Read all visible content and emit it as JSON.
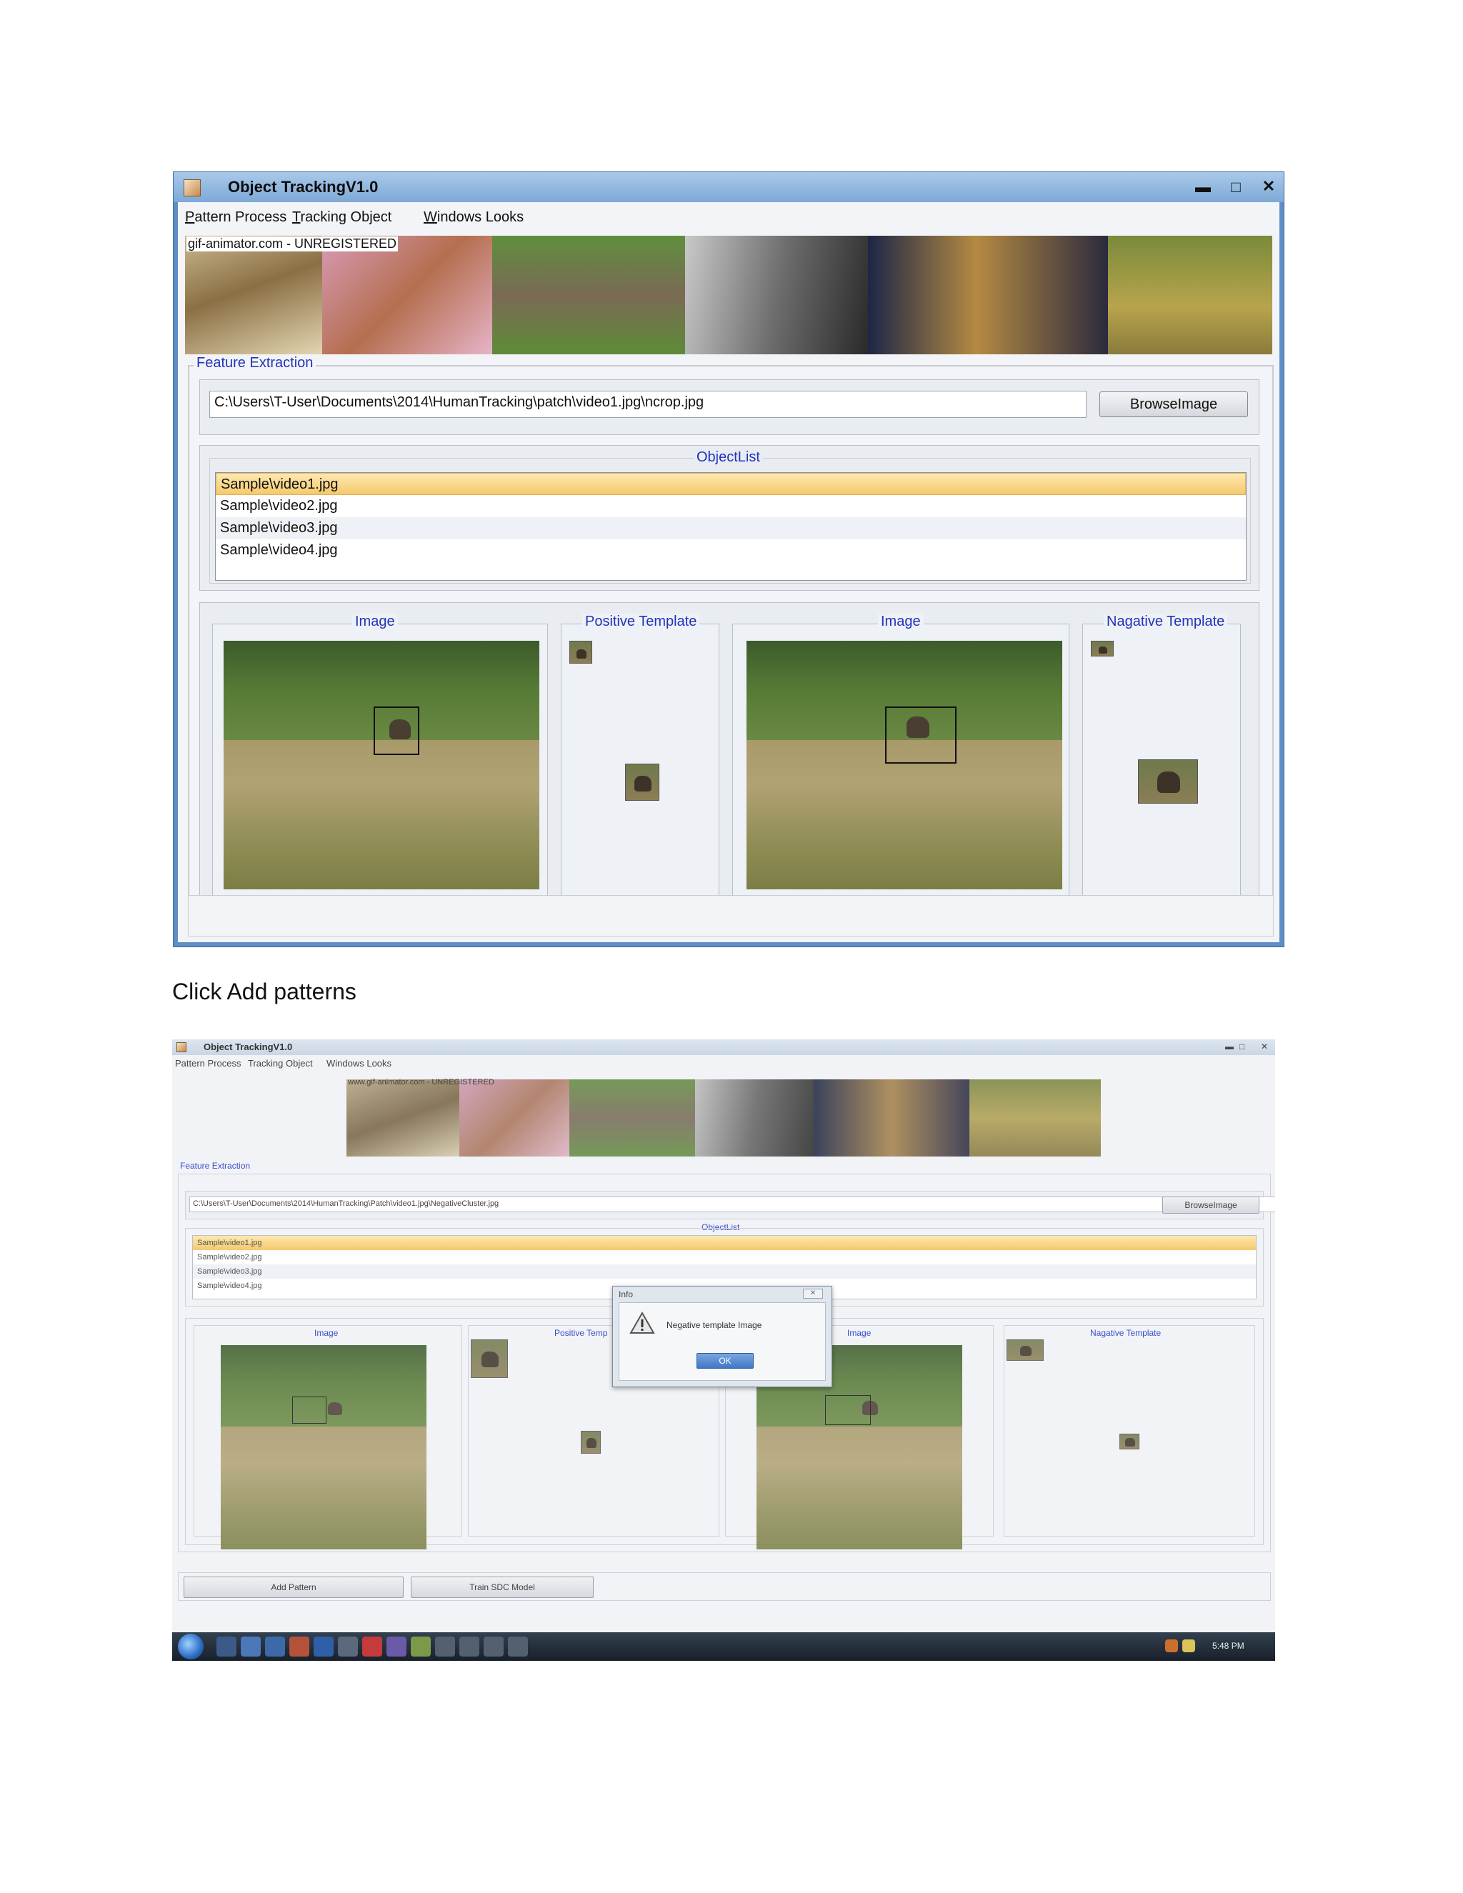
{
  "window1": {
    "title": "Object TrackingV1.0",
    "menu": [
      {
        "underline": "P",
        "rest": "attern Process"
      },
      {
        "underline": "T",
        "rest": "racking Object"
      },
      {
        "underline": "W",
        "rest": "indows Looks"
      }
    ],
    "banner_note": "gif-animator.com - UNREGISTERED",
    "feature_extraction_label": "Feature Extraction",
    "path_value": "C:\\Users\\T-User\\Documents\\2014\\HumanTracking\\patch\\video1.jpg\\ncrop.jpg",
    "browse_button": "BrowseImage",
    "object_list_label": "ObjectList",
    "object_list": [
      "Sample\\video1.jpg",
      "Sample\\video2.jpg",
      "Sample\\video3.jpg",
      "Sample\\video4.jpg"
    ],
    "panels": {
      "image1": "Image",
      "positive": "Positive Template",
      "image2": "Image",
      "negative": "Nagative Template"
    }
  },
  "caption": "Click Add patterns",
  "window2": {
    "title": "Object TrackingV1.0",
    "menu": [
      "Pattern Process",
      "Tracking Object",
      "Windows Looks"
    ],
    "banner_note": "www.gif-animator.com - UNREGISTERED",
    "feature_extraction_label": "Feature Extraction",
    "path_value": "C:\\Users\\T-User\\Documents\\2014\\HumanTracking\\Patch\\video1.jpg\\NegativeCluster.jpg",
    "browse_button": "BrowseImage",
    "object_list_label": "ObjectList",
    "object_list": [
      "Sample\\video1.jpg",
      "Sample\\video2.jpg",
      "Sample\\video3.jpg",
      "Sample\\video4.jpg"
    ],
    "panels": {
      "image1": "Image",
      "positive": "Positive Temp",
      "image2": "Image",
      "negative": "Nagative Template"
    },
    "dialog": {
      "title": "Info",
      "message": "Negative template Image",
      "ok": "OK"
    },
    "buttons": {
      "add_pattern": "Add Pattern",
      "train": "Train SDC Model"
    },
    "clock": "5:48 PM"
  },
  "colors": {
    "title_bar": "#7ea9d6",
    "legend_text": "#2233bb",
    "selection": "#f5c96c"
  },
  "icons": [
    "app-icon",
    "minimize-icon",
    "maximize-icon",
    "close-icon",
    "warning-icon",
    "start-orb-icon"
  ]
}
